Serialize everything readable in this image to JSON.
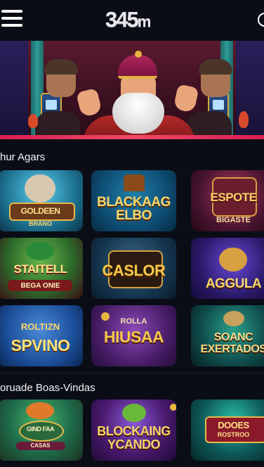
{
  "header": {
    "logo_main": "345",
    "logo_suffix": "m",
    "menu_icon": "hamburger-menu-icon",
    "user_icon": "user-icon"
  },
  "banner": {
    "theme": "wizard-casino-promo",
    "accent": "#e02a54"
  },
  "sections": [
    {
      "title": "hur Agars",
      "games": [
        {
          "title": "GOLDEEN",
          "subtitle": "BRANO",
          "bg": "#1a6b8a"
        },
        {
          "title": "BLACKAAG ELBO",
          "subtitle": "",
          "bg": "#0e4d74"
        },
        {
          "title": "ESPOTE",
          "subtitle": "BIGASTE",
          "bg": "#4a1430"
        },
        {
          "title": "STAITELL",
          "subtitle": "BEGA ONIE",
          "bg": "#2c6a2a"
        },
        {
          "title": "CASLOR",
          "subtitle": "",
          "bg": "#153650"
        },
        {
          "title": "AGGULA",
          "subtitle": "",
          "bg": "#2a1a6a"
        },
        {
          "title": "SPVINO",
          "subtitle": "ROLTIZN",
          "bg": "#1c4f9a"
        },
        {
          "title": "HIUSAA",
          "subtitle": "ROLLA",
          "bg": "#4a1e6a"
        },
        {
          "title": "SOANC EXERTADOS",
          "subtitle": "",
          "bg": "#0f4a4a"
        }
      ]
    },
    {
      "title": "oruade Boas-Vindas",
      "games": [
        {
          "title": "GIND FAA",
          "subtitle": "CASAS",
          "bg": "#1e6a4a"
        },
        {
          "title": "BLOCKAING YCANDO",
          "subtitle": "",
          "bg": "#4a1a70"
        },
        {
          "title": "DOOES",
          "subtitle": "ROSTROO",
          "bg": "#0e5a5a"
        }
      ]
    }
  ],
  "colors": {
    "background": "#0b0d16",
    "title_gold": "#f7c948",
    "divider": "#1e2232"
  }
}
